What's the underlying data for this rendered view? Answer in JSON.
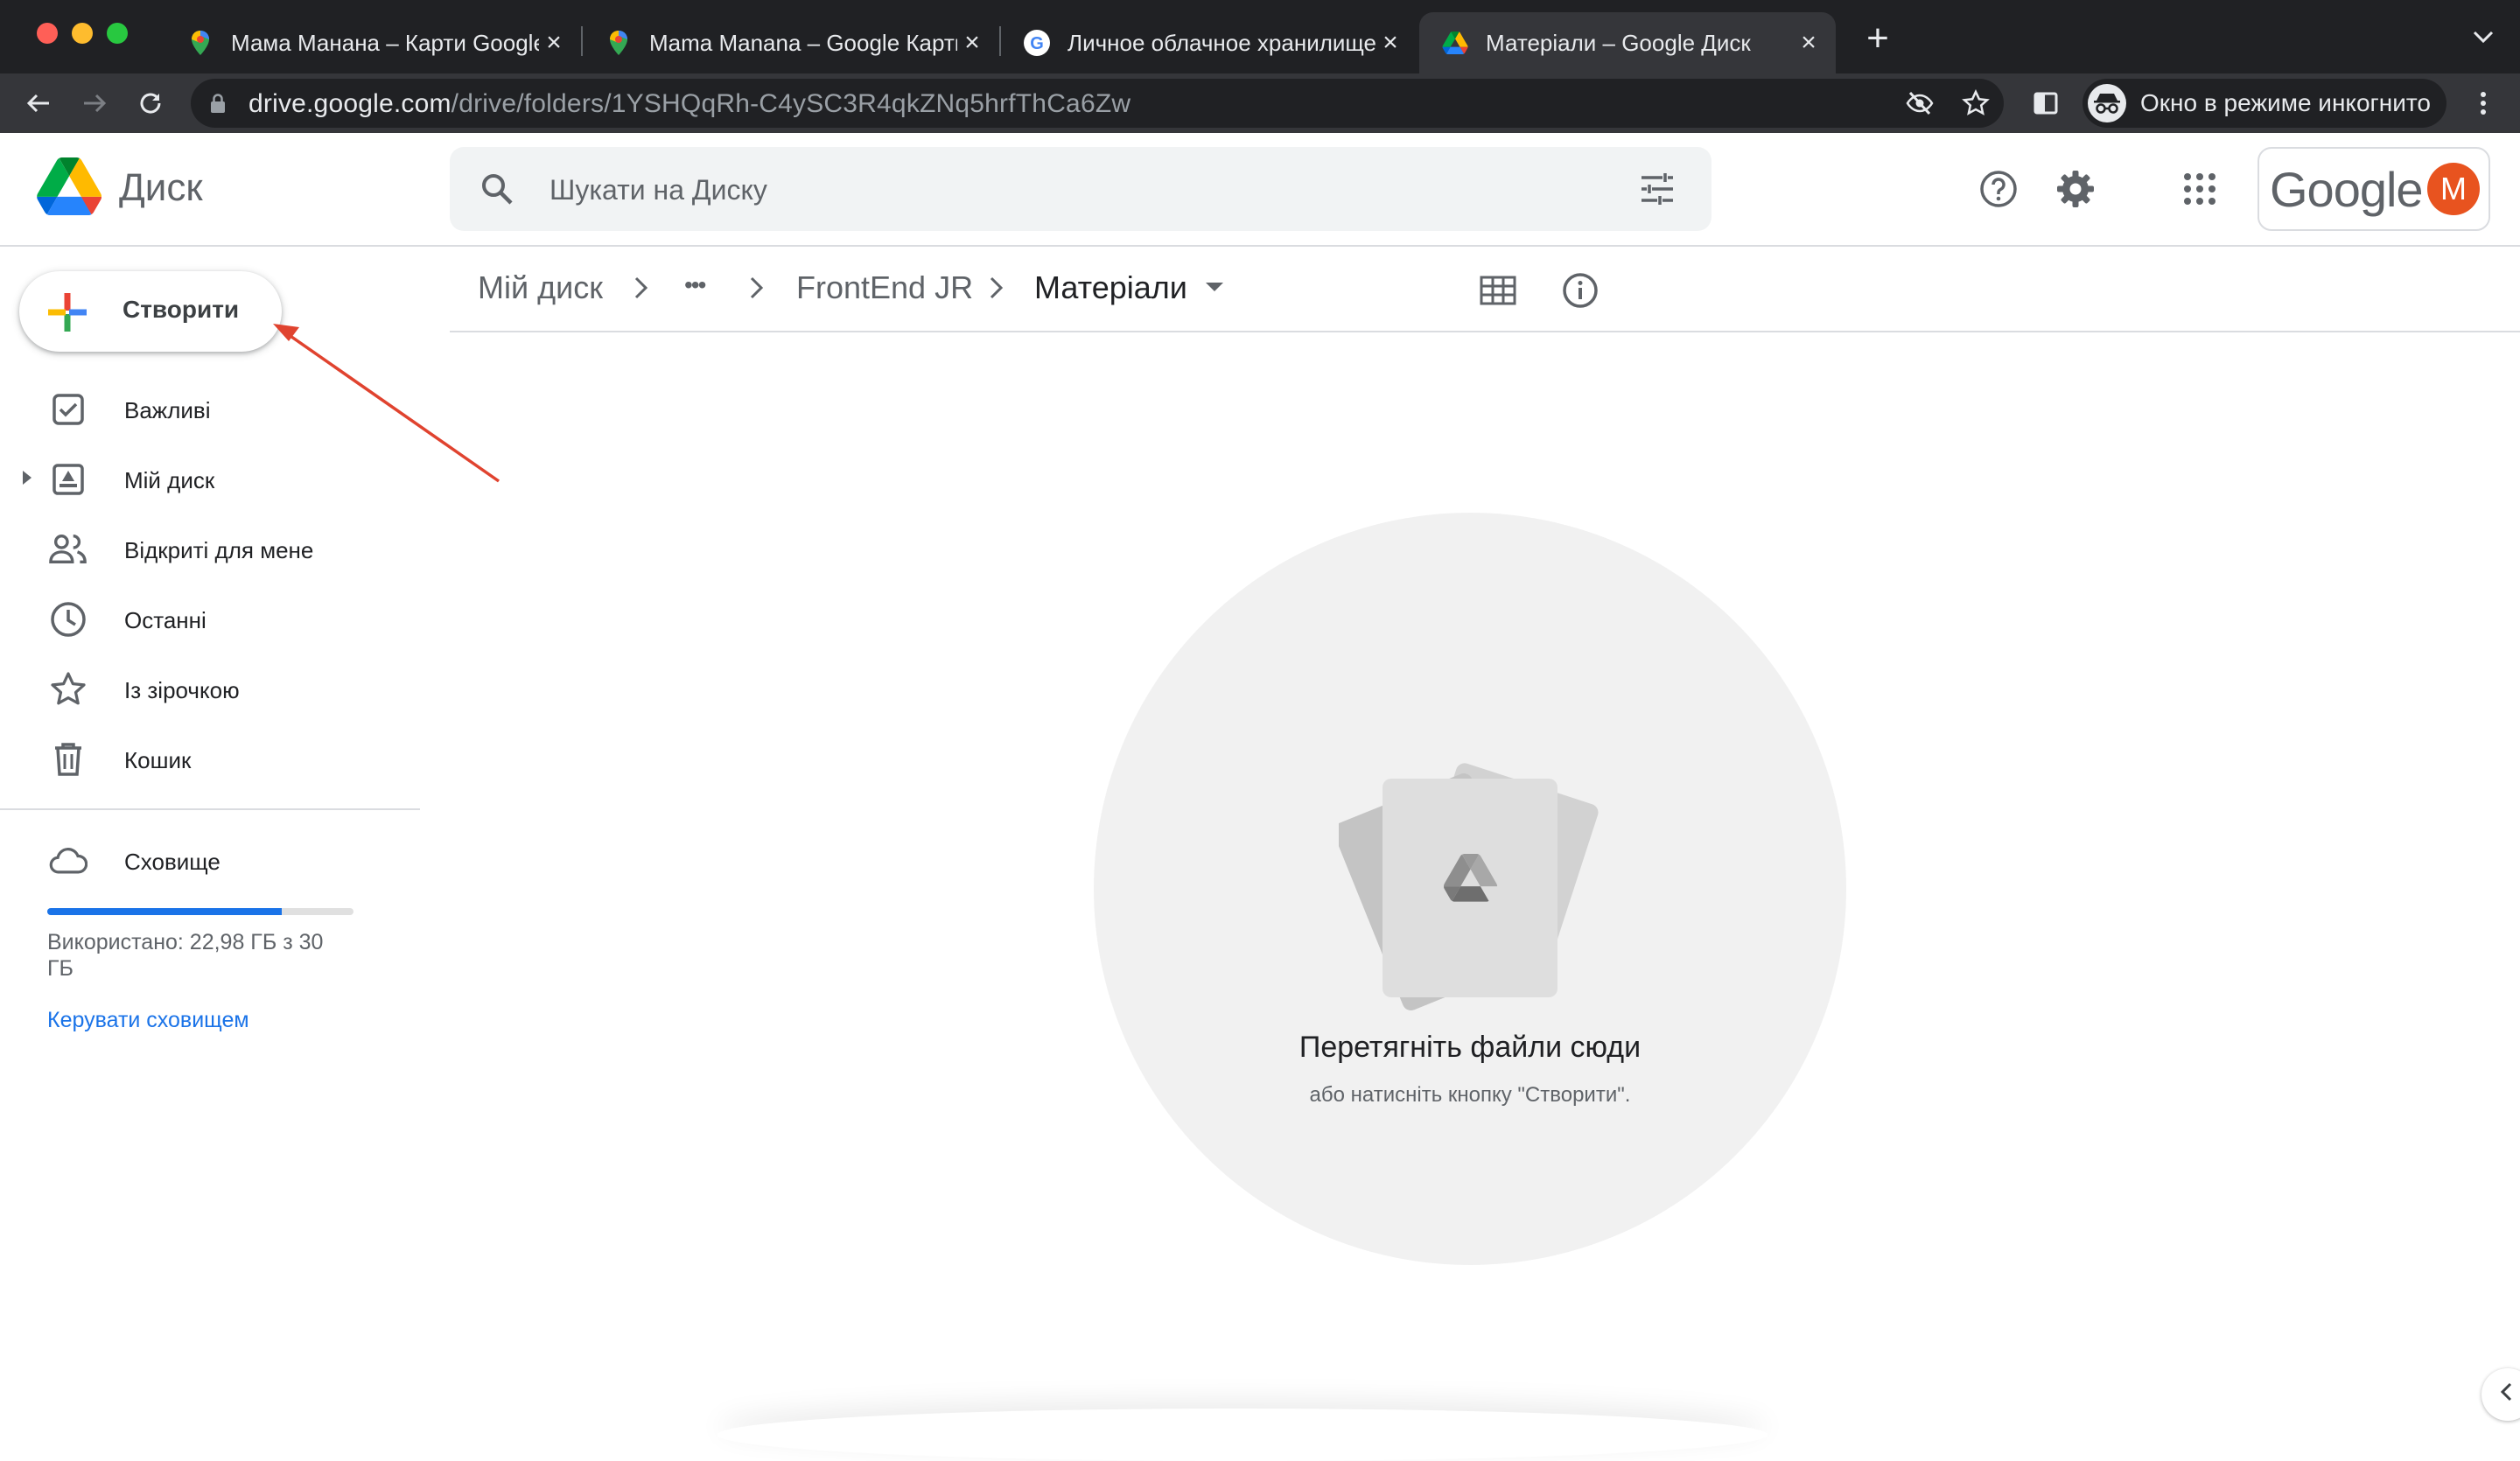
{
  "browser": {
    "tabs": [
      {
        "title": "Мама Манана – Карти Google",
        "icon": "maps-pin-icon"
      },
      {
        "title": "Mama Manana – Google Карты",
        "icon": "maps-pin-icon"
      },
      {
        "title": "Личное облачное хранилище",
        "icon": "google-g-icon"
      },
      {
        "title": "Матеріали – Google Диск",
        "icon": "drive-icon",
        "active": true
      }
    ],
    "url_host": "drive.google.com",
    "url_path": "/drive/folders/1YSHQqRh-C4ySC3R4qkZNq5hrfThCa6Zw",
    "incognito_label": "Окно в режиме инкогнито"
  },
  "drive": {
    "brand": "Диск",
    "search_placeholder": "Шукати на Диску",
    "account_brand": "Google",
    "avatar_letter": "M",
    "new_button": "Створити",
    "nav": [
      {
        "label": "Важливі",
        "icon": "priority-check-icon"
      },
      {
        "label": "Мій диск",
        "icon": "my-drive-icon"
      },
      {
        "label": "Відкриті для мене",
        "icon": "shared-people-icon"
      },
      {
        "label": "Останні",
        "icon": "clock-icon"
      },
      {
        "label": "Із зірочкою",
        "icon": "star-icon"
      },
      {
        "label": "Кошик",
        "icon": "trash-icon"
      }
    ],
    "storage": {
      "label": "Сховище",
      "used_text": "Використано: 22,98 ГБ з 30 ГБ",
      "used_fraction": 0.766,
      "manage_link": "Керувати сховищем"
    },
    "breadcrumb": {
      "root": "Мій диск",
      "ellipsis": "•••",
      "parent": "FrontEnd JR",
      "current": "Матеріали"
    },
    "empty_state": {
      "title": "Перетягніть файли сюди",
      "subtitle": "або натисніть кнопку \"Створити\"."
    }
  },
  "colors": {
    "accent": "#1a73e8",
    "avatar": "#e8531f",
    "annotation_arrow": "#e0432f"
  }
}
